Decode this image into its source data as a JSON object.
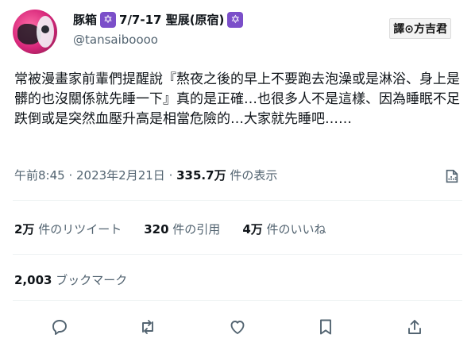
{
  "author": {
    "display_name": "豚箱",
    "name_suffix": "7/7-17 聖展(原宿)",
    "badge_glyph": "✡",
    "handle": "@tansaiboooo"
  },
  "translator_tag": "譯⊙方吉君",
  "tweet": {
    "text": "常被漫畫家前輩們提醒說『熬夜之後的早上不要跑去泡澡或是淋浴、身上是髒的也沒關係就先睡一下』真的是正確…也很多人不是這樣、因為睡眠不足跌倒或是突然血壓升高是相當危險的…大家就先睡吧……"
  },
  "meta": {
    "time": "午前8:45",
    "separator": " · ",
    "date": "2023年2月21日",
    "views_value": "335.7万",
    "views_label": " 件の表示"
  },
  "stats": {
    "retweets_value": "2万",
    "retweets_label": " 件のリツイート",
    "quotes_value": "320",
    "quotes_label": " 件の引用",
    "likes_value": "4万",
    "likes_label": " 件のいいね",
    "bookmarks_value": "2,003",
    "bookmarks_label": " ブックマーク"
  },
  "colors": {
    "text": "#0f1419",
    "muted": "#536471",
    "badge": "#7b4fc9",
    "divider": "#eff3f4"
  },
  "icons": [
    "reply-icon",
    "retweet-icon",
    "like-icon",
    "bookmark-icon",
    "share-icon",
    "analytics-icon"
  ]
}
